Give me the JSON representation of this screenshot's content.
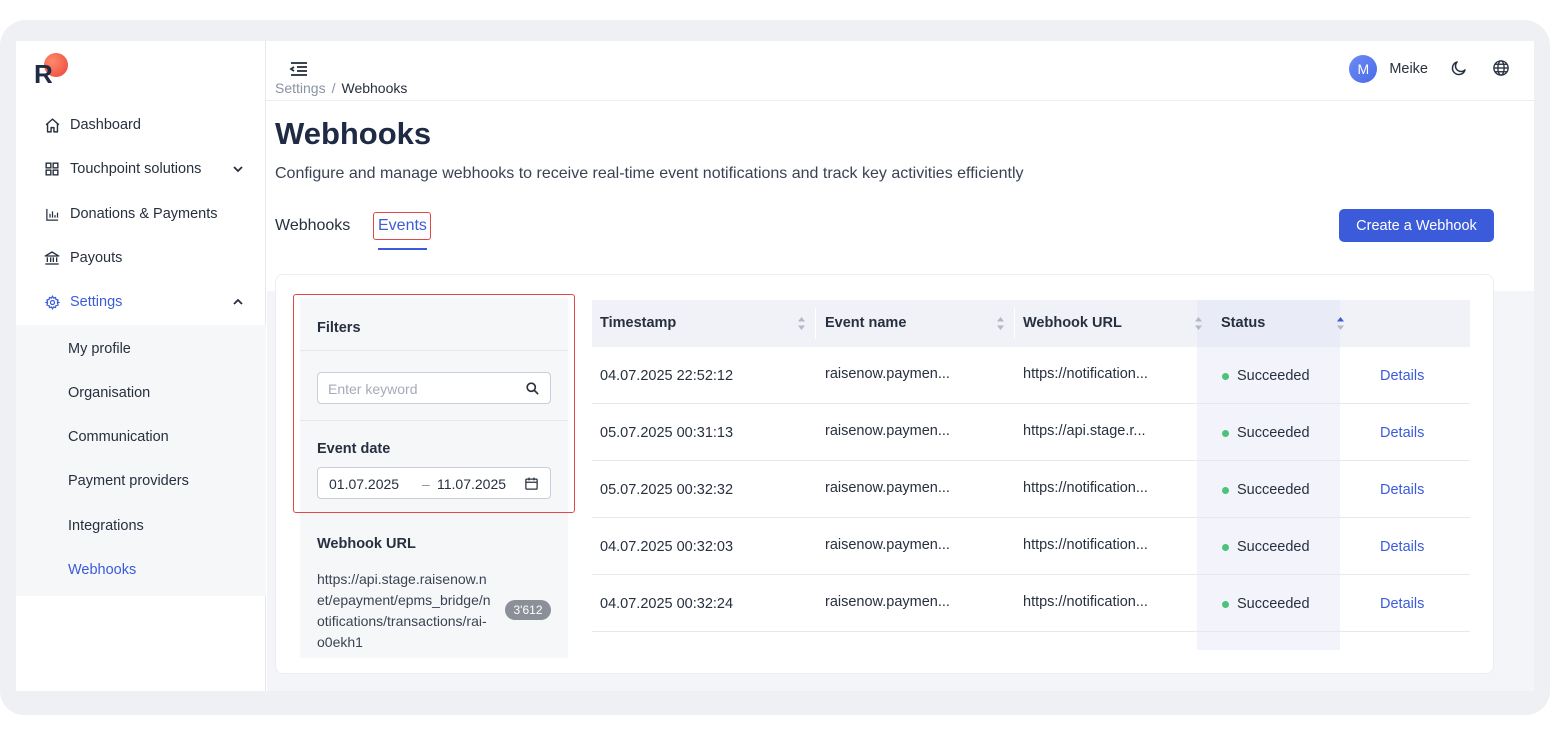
{
  "app": {
    "logo_letter": "R"
  },
  "sidebar": {
    "items": [
      {
        "label": "Dashboard",
        "icon": "home-icon"
      },
      {
        "label": "Touchpoint solutions",
        "icon": "grid-icon"
      },
      {
        "label": "Donations & Payments",
        "icon": "bar-chart-icon"
      },
      {
        "label": "Payouts",
        "icon": "bank-icon"
      },
      {
        "label": "Settings",
        "icon": "gear-icon"
      }
    ],
    "submenu": [
      {
        "label": "My profile"
      },
      {
        "label": "Organisation"
      },
      {
        "label": "Communication"
      },
      {
        "label": "Payment providers"
      },
      {
        "label": "Integrations"
      },
      {
        "label": "Webhooks"
      }
    ]
  },
  "header": {
    "user_initial": "M",
    "user_name": "Meike"
  },
  "breadcrumb": {
    "parent": "Settings",
    "separator": "/",
    "current": "Webhooks"
  },
  "page": {
    "title": "Webhooks",
    "subtitle": "Configure and manage webhooks to receive real-time event notifications and track key activities efficiently",
    "tabs": [
      {
        "label": "Webhooks"
      },
      {
        "label": "Events"
      }
    ],
    "create_button": "Create a Webhook"
  },
  "filters": {
    "title": "Filters",
    "search_placeholder": "Enter keyword",
    "event_date_label": "Event date",
    "date_from": "01.07.2025",
    "date_separator": "–",
    "date_to": "11.07.2025",
    "webhook_url_label": "Webhook URL",
    "webhook_url_value": "https://api.stage.raisenow.net/epayment/epms_bridge/notifications/transactions/rai-o0ekh1",
    "webhook_url_count": "3'612"
  },
  "table": {
    "headers": [
      "Timestamp",
      "Event name",
      "Webhook URL",
      "Status"
    ],
    "rows": [
      {
        "timestamp": "04.07.2025 22:52:12",
        "event": "raisenow.paymen...",
        "url": "https://notification...",
        "status": "Succeeded",
        "action": "Details"
      },
      {
        "timestamp": "05.07.2025 00:31:13",
        "event": "raisenow.paymen...",
        "url": "https://api.stage.r...",
        "status": "Succeeded",
        "action": "Details"
      },
      {
        "timestamp": "05.07.2025 00:32:32",
        "event": "raisenow.paymen...",
        "url": "https://notification...",
        "status": "Succeeded",
        "action": "Details"
      },
      {
        "timestamp": "04.07.2025 00:32:03",
        "event": "raisenow.paymen...",
        "url": "https://notification...",
        "status": "Succeeded",
        "action": "Details"
      },
      {
        "timestamp": "04.07.2025 00:32:24",
        "event": "raisenow.paymen...",
        "url": "https://notification...",
        "status": "Succeeded",
        "action": "Details"
      }
    ]
  },
  "colors": {
    "accent": "#3b5bdb",
    "highlight_outline": "#e04848",
    "success": "#4cc27a"
  }
}
